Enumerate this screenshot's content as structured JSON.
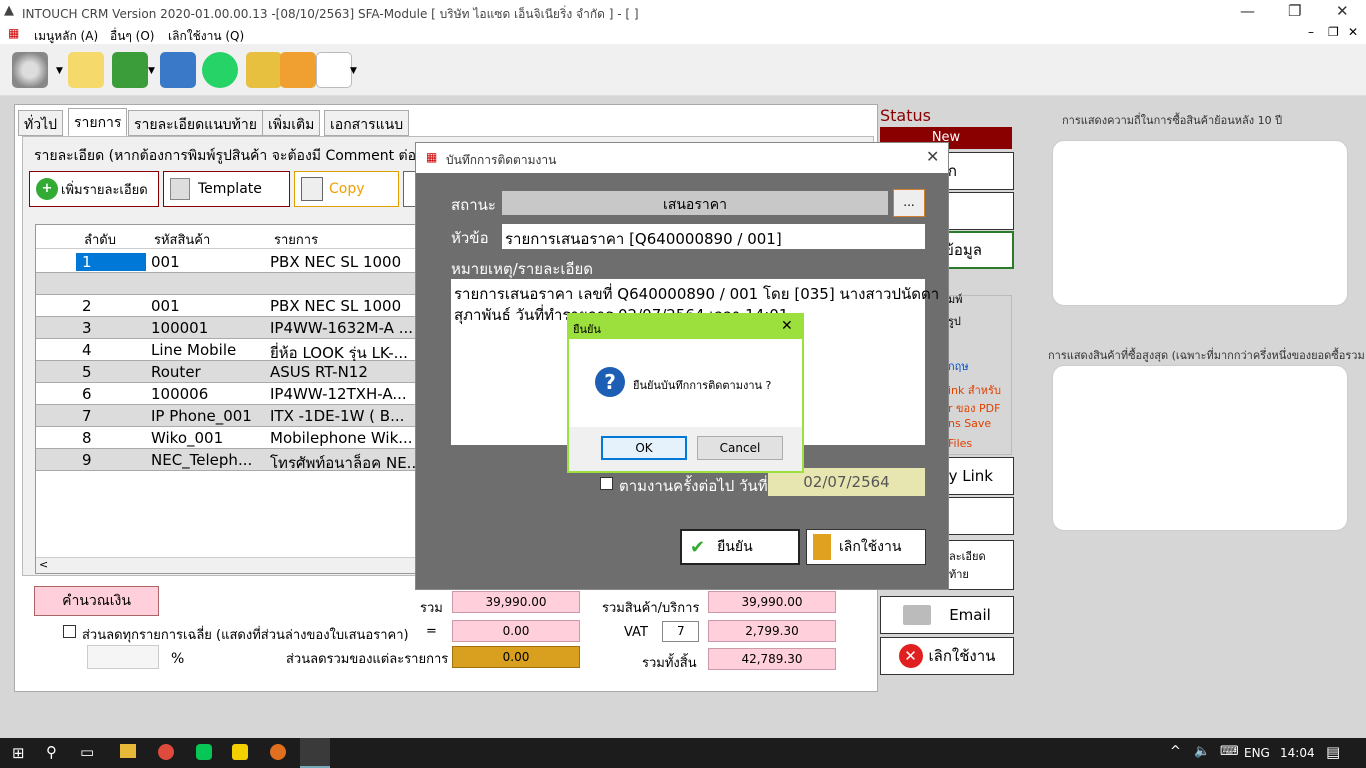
{
  "window": {
    "title": "INTOUCH CRM Version 2020-01.00.00.13 -[08/10/2563] SFA-Module  [ บริษัท ไอแซด เอ็นจิเนียริ่ง จำกัด ] - [ ]"
  },
  "menu": {
    "main": "เมนูหลัก (A)",
    "other": "อื่นๆ (O)",
    "quit": "เลิกใช้งาน (Q)"
  },
  "tabs": [
    "ทั่วไป",
    "รายการ",
    "รายละเอียดแนบท้าย",
    "เพิ่มเติม",
    "เอกสารแนบ"
  ],
  "detail": {
    "header": "รายละเอียด (หากต้องการพิมพ์รูปสินค้า จะต้องมี Comment ต่อจ",
    "add_button": "เพิ่มรายละเอียด",
    "template_button": "Template",
    "copy_button": "Copy"
  },
  "grid": {
    "columns": [
      "ลำดับ",
      "รหัสสินค้า",
      "รายการ"
    ],
    "rows": [
      {
        "no": "1",
        "code": "001",
        "item": "PBX NEC SL 1000"
      },
      {
        "no": "",
        "code": "",
        "item": ""
      },
      {
        "no": "2",
        "code": "001",
        "item": "PBX NEC SL 1000"
      },
      {
        "no": "3",
        "code": "100001",
        "item": "IP4WW-1632M-A ..."
      },
      {
        "no": "4",
        "code": "Line Mobile",
        "item": "ยี่ห้อ LOOK รุ่น LK-..."
      },
      {
        "no": "5",
        "code": "Router",
        "item": "ASUS RT-N12"
      },
      {
        "no": "6",
        "code": "100006",
        "item": "IP4WW-12TXH-A..."
      },
      {
        "no": "7",
        "code": "IP Phone_001",
        "item": "ITX -1DE-1W ( B..."
      },
      {
        "no": "8",
        "code": "Wiko_001",
        "item": "Mobilephone Wik..."
      },
      {
        "no": "9",
        "code": "NEC_Teleph...",
        "item": "โทรศัพท์อนาล็อค NE..."
      }
    ]
  },
  "totals": {
    "calc_button": "คำนวณเงิน",
    "sum_label": "รวม",
    "sum_value": "39,990.00",
    "avg_discount_label": "ส่วนลดทุกรายการเฉลี่ย (แสดงที่ส่วนล่างของใบเสนอราคา)",
    "eq": "=",
    "avg_discount_value": "0.00",
    "percent": "%",
    "item_discount_label": "ส่วนลดรวมของแต่ละรายการ",
    "item_discount_value": "0.00",
    "goods_label": "รวมสินค้า/บริการ",
    "goods_value": "39,990.00",
    "vat_label": "VAT",
    "vat_rate": "7",
    "vat_value": "2,799.30",
    "grand_label": "รวมทั้งสิ้น",
    "grand_value": "42,789.30"
  },
  "status": {
    "label": "Status",
    "value": "New"
  },
  "right": {
    "btn_partial1": "ก",
    "btn_partial2": "ข้อมูล",
    "print_group_partial": "มพ์",
    "rup": "รูป",
    "eng": "กฤษ",
    "red1": "ink สำหรับ",
    "red2": "r ของ PDF",
    "red3": "ns Save",
    "red4": "Files",
    "copy_link": "py Link",
    "attach1": "ละเอียด",
    "attach2": "ท้าย",
    "email": "Email",
    "quit": "เลิกใช้งาน"
  },
  "far_right": {
    "chart1_title": "การแสดงความถี่ในการซื้อสินค้าย้อนหลัง 10 ปี",
    "chart2_title": "การแสดงสินค้าที่ซื้อสูงสุด (เฉพาะที่มากกว่าครึ่งหนึ่งของยอดซื้อรวม"
  },
  "dialog": {
    "title": "บันทึกการติดตามงาน",
    "status_label": "สถานะ",
    "status_value": "เสนอราคา",
    "browse": "...",
    "subject_label": "หัวข้อ",
    "subject_value": "รายการเสนอราคา [Q640000890 / 001]",
    "note_label": "หมายเหตุ/รายละเอียด",
    "note_line1": "รายการเสนอราคา เลขที่  Q640000890 / 001 โดย [035] นางสาวปนัดดา",
    "note_line2": "สุภาพันธ์ วันที่ทำรายการ 02/07/2564 เวลา 14:01",
    "followup_label": "ตามงานครั้งต่อไป วันที่",
    "followup_date": "02/07/2564",
    "confirm_button": "ยืนยัน",
    "cancel_button": "เลิกใช้งาน"
  },
  "confirm": {
    "title": "ยืนยัน",
    "message": "ยืนยันบันทึกการติดตามงาน ?",
    "ok": "OK",
    "cancel": "Cancel"
  },
  "taskbar": {
    "lang": "ENG",
    "time": "14:04"
  }
}
